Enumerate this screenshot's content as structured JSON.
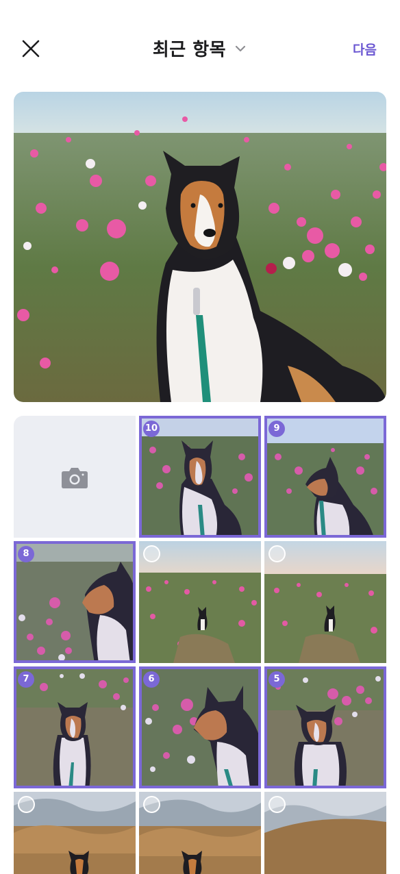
{
  "header": {
    "title": "최근 항목",
    "next_label": "다음",
    "close_icon": "close-icon",
    "dropdown_icon": "chevron-down-icon"
  },
  "accent_color": "#7b68d6",
  "grid": {
    "camera_icon": "camera-icon",
    "items": [
      {
        "selected": true,
        "order": "10"
      },
      {
        "selected": true,
        "order": "9"
      },
      {
        "selected": true,
        "order": "8"
      },
      {
        "selected": false,
        "order": ""
      },
      {
        "selected": false,
        "order": ""
      },
      {
        "selected": true,
        "order": "7"
      },
      {
        "selected": true,
        "order": "6"
      },
      {
        "selected": true,
        "order": "5"
      },
      {
        "selected": false,
        "order": ""
      },
      {
        "selected": false,
        "order": ""
      },
      {
        "selected": false,
        "order": ""
      }
    ]
  }
}
